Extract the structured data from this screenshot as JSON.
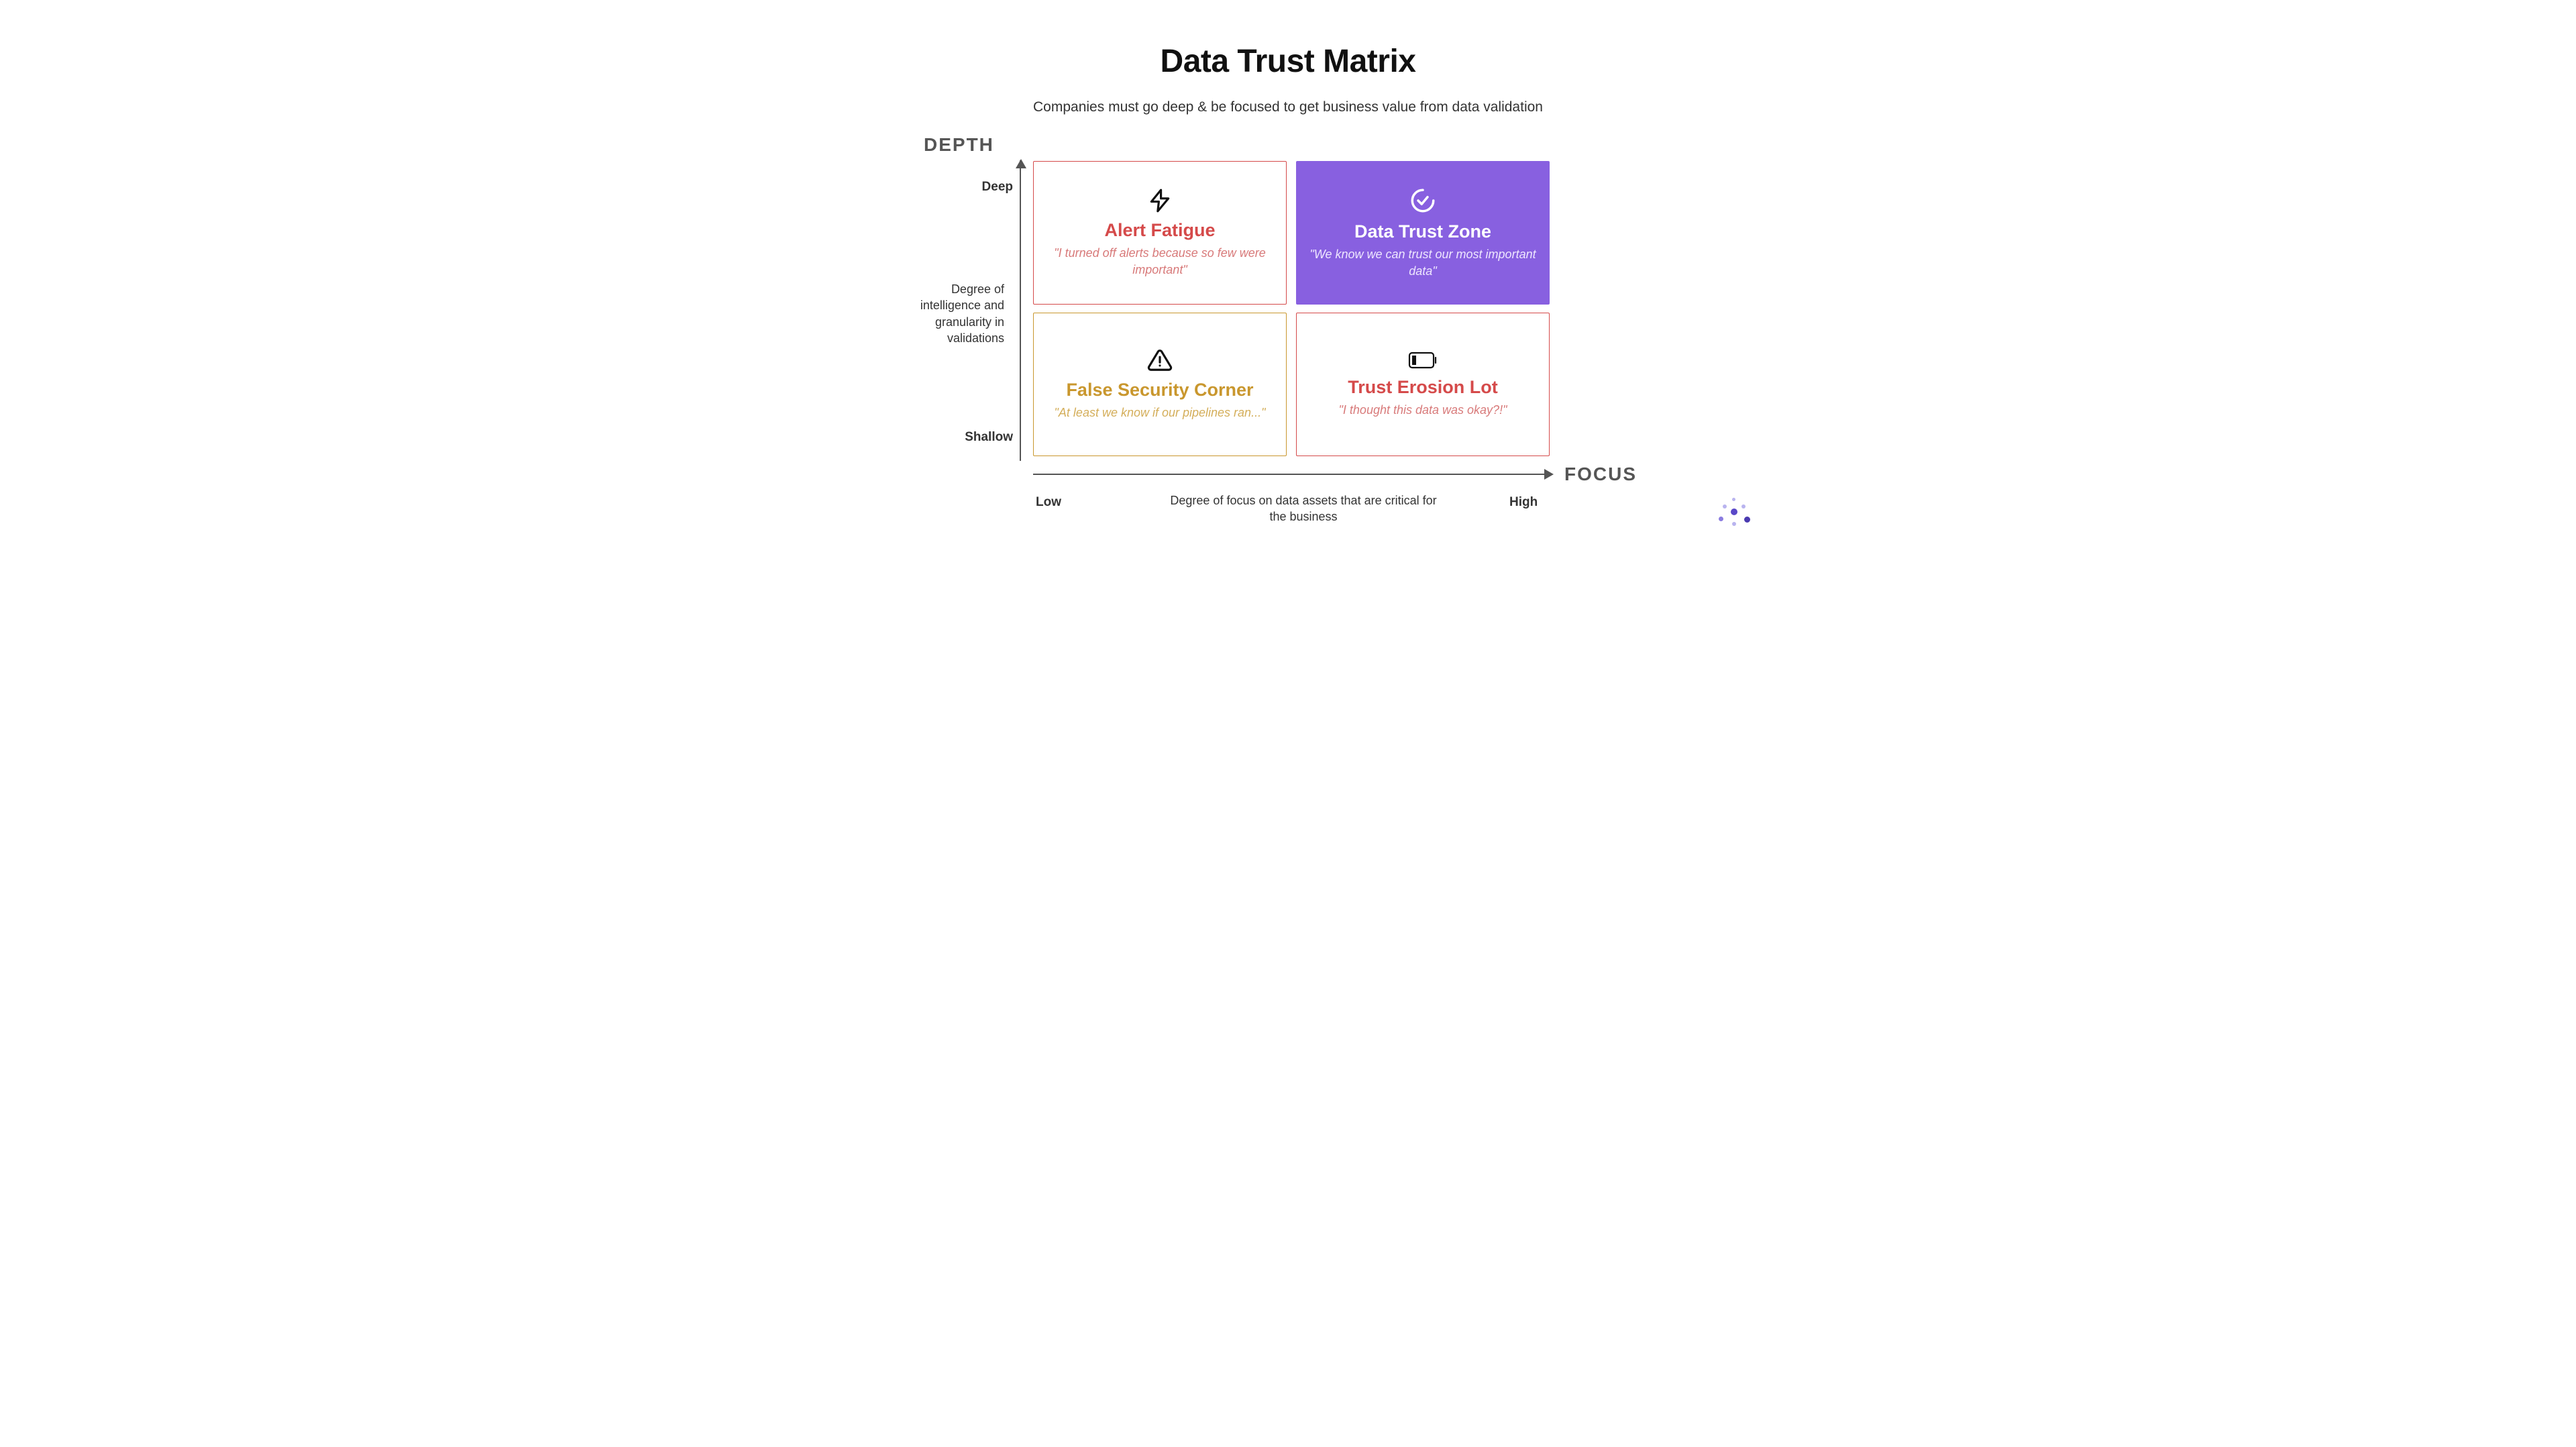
{
  "title": "Data Trust Matrix",
  "subtitle": "Companies must go deep & be focused to get business value from data validation",
  "axes": {
    "y": {
      "title": "DEPTH",
      "topTick": "Deep",
      "bottomTick": "Shallow",
      "description": "Degree of intelligence and granularity in validations"
    },
    "x": {
      "title": "FOCUS",
      "leftTick": "Low",
      "rightTick": "High",
      "description": "Degree of focus on data assets that are critical for the business"
    }
  },
  "quadrants": {
    "top_left": {
      "icon": "lightning",
      "heading": "Alert Fatigue",
      "quote": "\"I turned off alerts because so few were important\""
    },
    "top_right": {
      "icon": "check-circle",
      "heading": "Data Trust Zone",
      "quote": "\"We know we can trust our most important data\""
    },
    "bottom_left": {
      "icon": "warning-triangle",
      "heading": "False Security Corner",
      "quote": "\"At least we know if our pipelines ran...\""
    },
    "bottom_right": {
      "icon": "battery-low",
      "heading": "Trust Erosion Lot",
      "quote": "\"I thought this data was okay?!\""
    }
  },
  "colors": {
    "red": "#d54a4a",
    "gold": "#c9972e",
    "purple": "#8860e0",
    "axis": "#555"
  }
}
